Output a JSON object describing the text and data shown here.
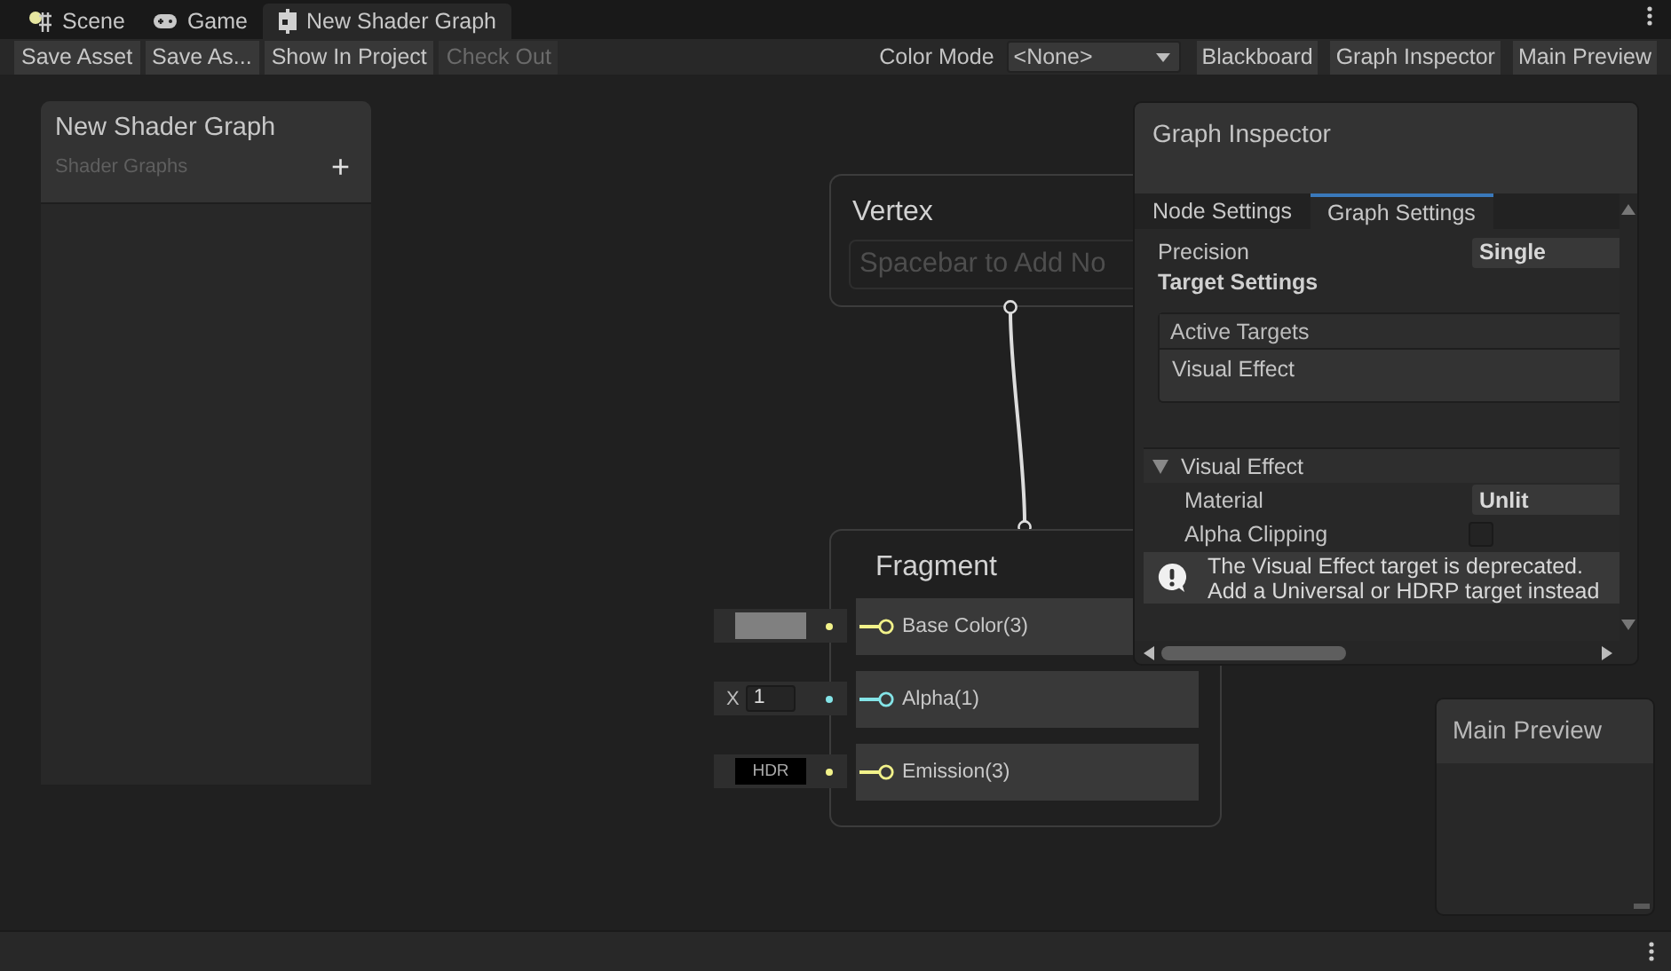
{
  "tabs": [
    {
      "label": "Scene",
      "kind": "scene",
      "selected": false
    },
    {
      "label": "Game",
      "kind": "game",
      "selected": false
    },
    {
      "label": "New Shader Graph",
      "kind": "shader",
      "selected": true
    }
  ],
  "toolbar": {
    "buttons": [
      {
        "label": "Save Asset",
        "disabled": false
      },
      {
        "label": "Save As...",
        "disabled": false
      },
      {
        "label": "Show In Project",
        "disabled": false
      },
      {
        "label": "Check Out",
        "disabled": true
      }
    ],
    "color_mode": {
      "label": "Color Mode",
      "value": "<None>"
    },
    "toggles": [
      {
        "label": "Blackboard"
      },
      {
        "label": "Graph Inspector"
      },
      {
        "label": "Main Preview"
      }
    ]
  },
  "blackboard": {
    "title": "New Shader Graph",
    "subtitle": "Shader Graphs",
    "add": "+"
  },
  "vertex": {
    "title": "Vertex",
    "placeholder": "Spacebar to Add No"
  },
  "fragment": {
    "title": "Fragment",
    "ports": [
      {
        "label": "Base Color(3)",
        "kind": "color",
        "color": "#f2f28a"
      },
      {
        "label": "Alpha(1)",
        "kind": "float",
        "color": "#84e4e7",
        "axis": "X",
        "value": "1"
      },
      {
        "label": "Emission(3)",
        "kind": "hdr",
        "color": "#f2f28a",
        "value": "HDR"
      }
    ]
  },
  "inspector": {
    "title": "Graph Inspector",
    "tabs": [
      {
        "label": "Node Settings",
        "selected": false
      },
      {
        "label": "Graph Settings",
        "selected": true
      }
    ],
    "precision": {
      "label": "Precision",
      "value": "Single"
    },
    "heading": "Target Settings",
    "active_targets": {
      "header": "Active Targets",
      "items": [
        "Visual Effect"
      ]
    },
    "section": {
      "title": "Visual Effect",
      "expanded": true,
      "rows": [
        {
          "kind": "dropdown",
          "label": "Material",
          "value": "Unlit"
        },
        {
          "kind": "checkbox",
          "label": "Alpha Clipping",
          "checked": false
        }
      ]
    },
    "warning": "The Visual Effect target is deprecated.\nAdd a Universal or HDRP target instead"
  },
  "main_preview": {
    "title": "Main Preview"
  }
}
